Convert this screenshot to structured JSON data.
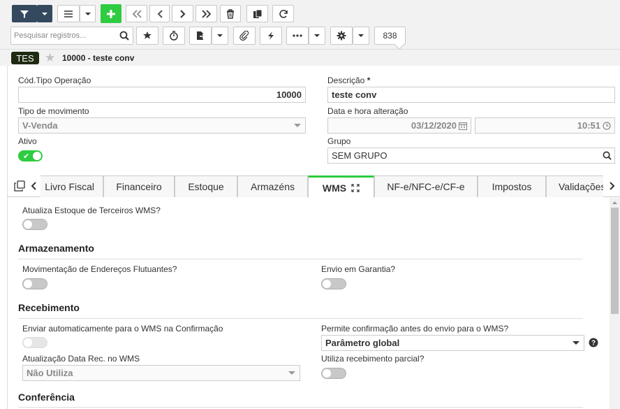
{
  "toolbar": {
    "search_placeholder": "Pesquisar registros...",
    "record_count": "838",
    "colors": {
      "dark": "#34495e",
      "green": "#2ecc40"
    }
  },
  "breadcrumb": {
    "badge": "TES",
    "title": "10000 - teste conv"
  },
  "form": {
    "cod_tipo_label": "Cód.Tipo Operação",
    "cod_tipo_value": "10000",
    "descricao_label": "Descrição",
    "descricao_required": "*",
    "descricao_value": "teste conv",
    "tipo_mov_label": "Tipo de movimento",
    "tipo_mov_value": "V-Venda",
    "data_hora_label": "Data e hora alteração",
    "data_value": "03/12/2020",
    "hora_value": "10:51",
    "ativo_label": "Ativo",
    "grupo_label": "Grupo",
    "grupo_value": "SEM GRUPO"
  },
  "tabs": [
    {
      "label": "Livro Fiscal"
    },
    {
      "label": "Financeiro"
    },
    {
      "label": "Estoque"
    },
    {
      "label": "Armazéns"
    },
    {
      "label": "WMS",
      "active": true
    },
    {
      "label": "NF-e/NFC-e/CF-e"
    },
    {
      "label": "Impostos"
    },
    {
      "label": "Validações"
    }
  ],
  "wms": {
    "atualiza_estoque_label": "Atualiza Estoque de Terceiros WMS?",
    "armazenamento_title": "Armazenamento",
    "mov_enderecos_label": "Movimentação de Endereços Flutuantes?",
    "envio_garantia_label": "Envio em Garantia?",
    "recebimento_title": "Recebimento",
    "enviar_auto_label": "Enviar automaticamente para o WMS na Confirmação",
    "permite_conf_label": "Permite confirmação antes do envio para o WMS?",
    "permite_conf_value": "Parâmetro global",
    "atualizacao_data_label": "Atualização Data Rec. no WMS",
    "atualizacao_data_value": "Não Utiliza",
    "utiliza_receb_label": "Utiliza recebimento parcial?",
    "conferencia_title": "Conferência"
  },
  "toggles": {
    "ativo": true,
    "atualiza_estoque": false,
    "mov_enderecos": false,
    "envio_garantia": false,
    "enviar_auto": false,
    "utiliza_receb": false
  }
}
